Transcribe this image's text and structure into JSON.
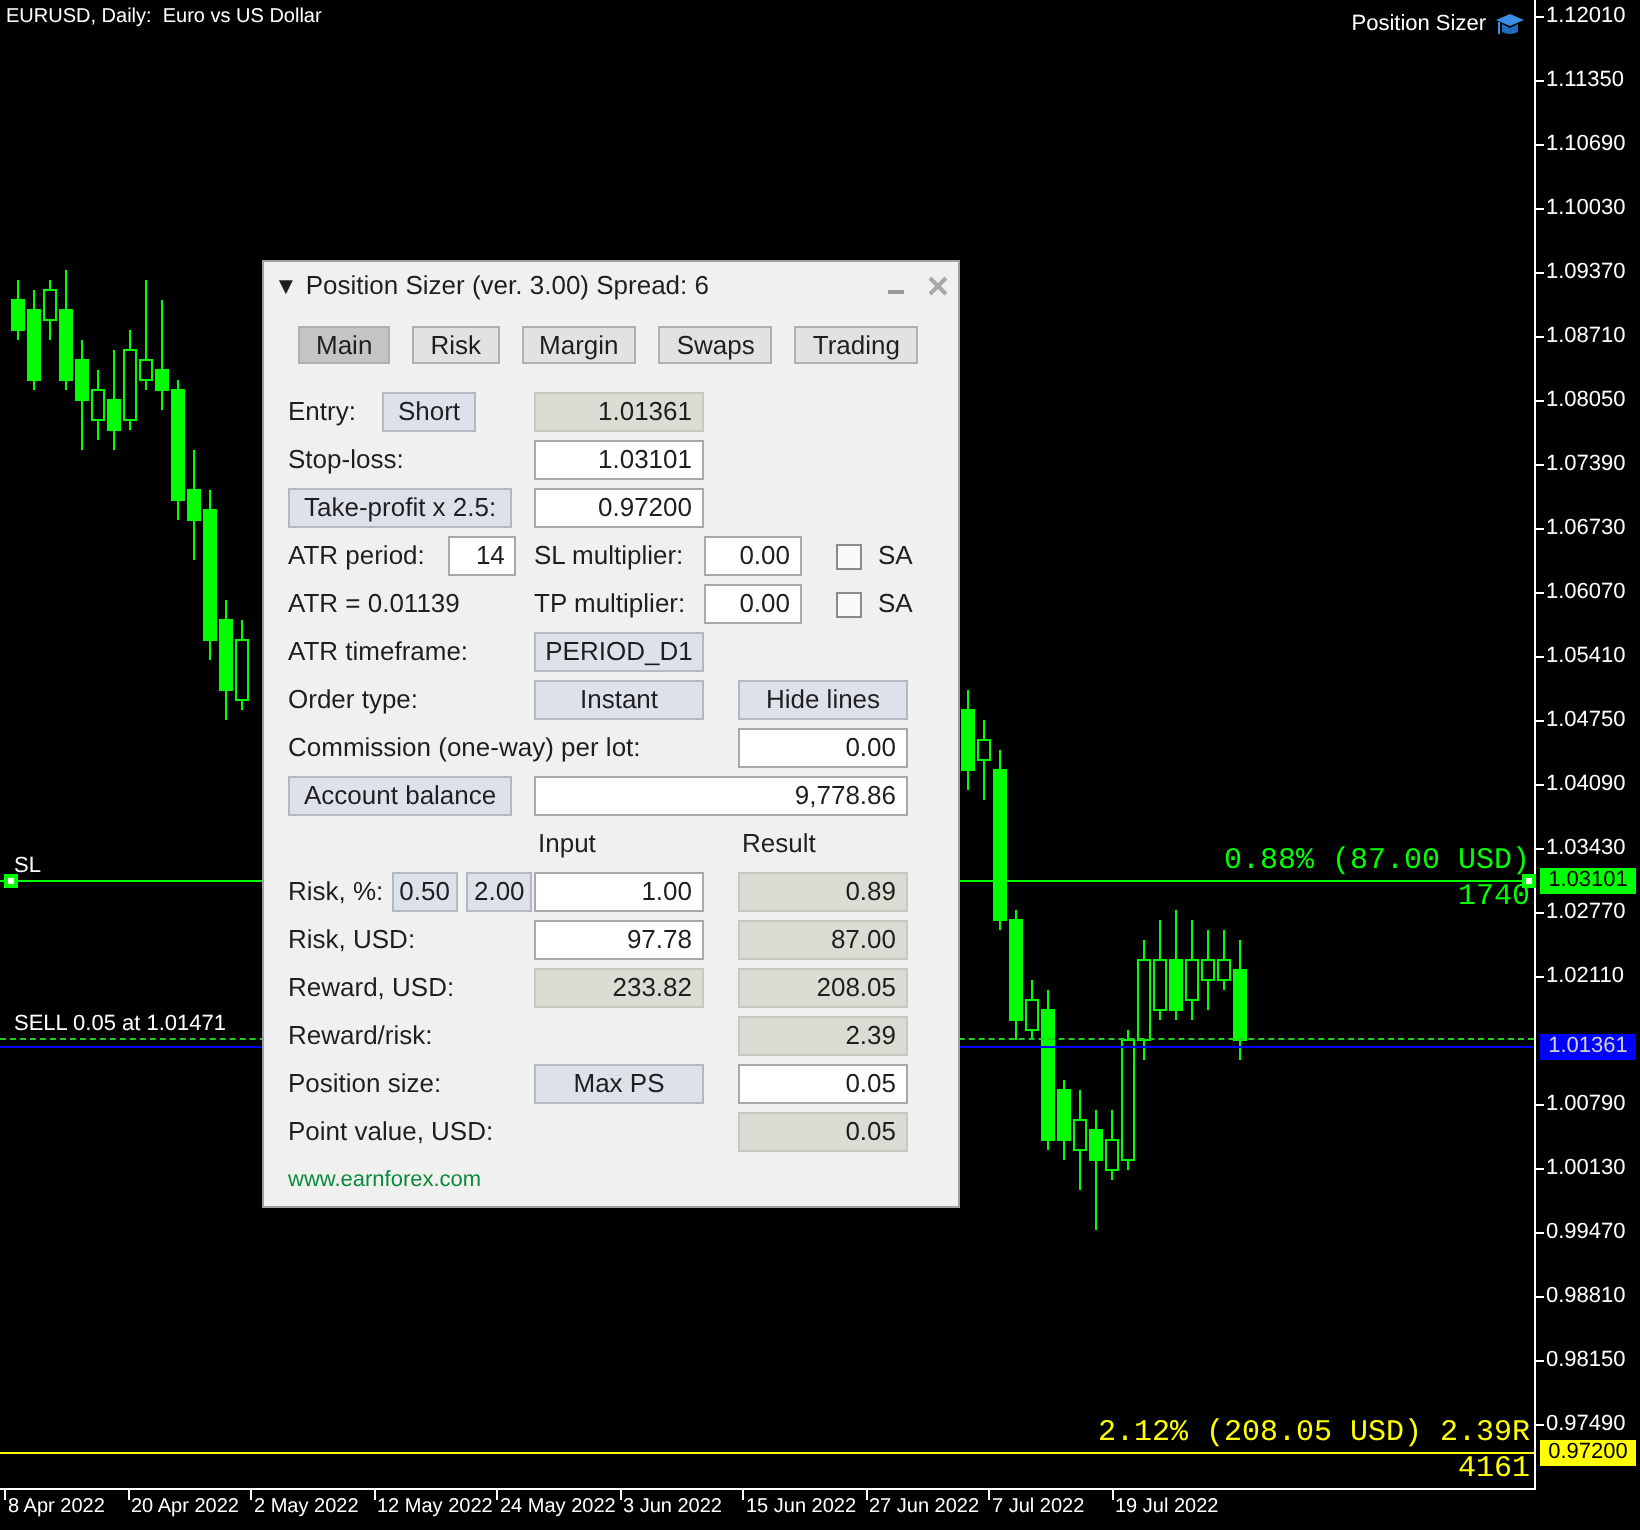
{
  "chart": {
    "title": "EURUSD, Daily:  Euro vs US Dollar",
    "indicator_label": "Position Sizer",
    "price_axis": {
      "upper": [
        "1.12010",
        "1.11350",
        "1.10690",
        "1.10030",
        "1.09370",
        "1.08710",
        "1.08050",
        "1.07390",
        "1.06730",
        "1.06070",
        "1.05410",
        "1.04750",
        "1.04090",
        "1.03430",
        "1.02770",
        "1.02110"
      ],
      "lower": [
        "1.00790",
        "1.00130",
        "0.99470",
        "0.98810",
        "0.98150",
        "0.97490"
      ]
    },
    "date_axis": [
      "8 Apr 2022",
      "20 Apr 2022",
      "2 May 2022",
      "12 May 2022",
      "24 May 2022",
      "3 Jun 2022",
      "15 Jun 2022",
      "27 Jun 2022",
      "7 Jul 2022",
      "19 Jul 2022"
    ],
    "lines": [
      {
        "kind": "sl",
        "label": "SL",
        "info": "0.88% (87.00 USD)",
        "points": "1740",
        "price": "1.03101",
        "color": "#00ff00"
      },
      {
        "kind": "order",
        "label": "SELL 0.05 at 1.01471",
        "color": "#22cc22"
      },
      {
        "kind": "entry",
        "price": "1.01361",
        "color": "#0000ff"
      },
      {
        "kind": "tp",
        "info": "2.12% (208.05 USD) 2.39R",
        "points": "4161",
        "price": "0.97200",
        "color": "#ffff00"
      }
    ]
  },
  "panel": {
    "collapse_glyph": "▼",
    "title": "Position Sizer (ver. 3.00) Spread: 6",
    "tabs": [
      {
        "label": "Main",
        "selected": true
      },
      {
        "label": "Risk",
        "selected": false
      },
      {
        "label": "Margin",
        "selected": false
      },
      {
        "label": "Swaps",
        "selected": false
      },
      {
        "label": "Trading",
        "selected": false
      }
    ],
    "rows": [
      {
        "kind": "grid",
        "left": [
          {
            "kind": "label",
            "text": "Entry:"
          },
          {
            "kind": "button",
            "text": "Short"
          }
        ],
        "input": {
          "kind": "field",
          "value": "1.01361",
          "editable": false
        }
      },
      {
        "kind": "grid",
        "left": [
          {
            "kind": "label",
            "text": "Stop-loss:"
          }
        ],
        "input": {
          "kind": "field",
          "value": "1.03101",
          "editable": true
        }
      },
      {
        "kind": "grid",
        "left": [
          {
            "kind": "button",
            "text": "Take-profit x 2.5:"
          }
        ],
        "input": {
          "kind": "field",
          "value": "0.97200",
          "editable": true
        }
      },
      {
        "kind": "multiplier",
        "left": [
          {
            "kind": "label",
            "text": "ATR period:"
          },
          {
            "kind": "field",
            "value": "14",
            "editable": true
          }
        ],
        "extra": [
          {
            "kind": "label",
            "text": "SL multiplier:"
          },
          {
            "kind": "field",
            "value": "0.00",
            "editable": true
          },
          {
            "kind": "checkbox",
            "checked": false,
            "text": "SA"
          }
        ]
      },
      {
        "kind": "multiplier",
        "left": [
          {
            "kind": "label",
            "text": "ATR = 0.01139"
          }
        ],
        "extra": [
          {
            "kind": "label",
            "text": "TP multiplier:"
          },
          {
            "kind": "field",
            "value": "0.00",
            "editable": true
          },
          {
            "kind": "checkbox",
            "checked": false,
            "text": "SA"
          }
        ]
      },
      {
        "kind": "grid",
        "left": [
          {
            "kind": "label",
            "text": "ATR timeframe:"
          }
        ],
        "input": {
          "kind": "button",
          "text": "PERIOD_D1"
        }
      },
      {
        "kind": "grid",
        "left": [
          {
            "kind": "label",
            "text": "Order type:"
          }
        ],
        "input": {
          "kind": "button",
          "text": "Instant"
        },
        "result": {
          "kind": "button",
          "text": "Hide lines"
        }
      },
      {
        "kind": "wide_label",
        "left": [
          {
            "kind": "label",
            "text": "Commission (one-way) per lot:"
          }
        ],
        "result": {
          "kind": "field",
          "value": "0.00",
          "editable": true
        }
      },
      {
        "kind": "balance",
        "left": [
          {
            "kind": "button",
            "text": "Account balance"
          }
        ],
        "input": {
          "kind": "field",
          "value": "9,778.86",
          "editable": true
        }
      },
      {
        "kind": "grid",
        "input": {
          "kind": "heading",
          "text": "Input"
        },
        "result": {
          "kind": "heading",
          "text": "Result"
        }
      },
      {
        "kind": "grid",
        "left": [
          {
            "kind": "label",
            "text": "Risk, %:"
          },
          {
            "kind": "small_button",
            "text": "0.50"
          },
          {
            "kind": "small_button",
            "text": "2.00"
          }
        ],
        "input": {
          "kind": "field",
          "value": "1.00",
          "editable": true
        },
        "result": {
          "kind": "field",
          "value": "0.89",
          "editable": false
        }
      },
      {
        "kind": "grid",
        "left": [
          {
            "kind": "label",
            "text": "Risk, USD:"
          }
        ],
        "input": {
          "kind": "field",
          "value": "97.78",
          "editable": true
        },
        "result": {
          "kind": "field",
          "value": "87.00",
          "editable": false
        }
      },
      {
        "kind": "grid",
        "left": [
          {
            "kind": "label",
            "text": "Reward, USD:"
          }
        ],
        "input": {
          "kind": "field",
          "value": "233.82",
          "editable": false
        },
        "result": {
          "kind": "field",
          "value": "208.05",
          "editable": false
        }
      },
      {
        "kind": "grid",
        "left": [
          {
            "kind": "label",
            "text": "Reward/risk:"
          }
        ],
        "result": {
          "kind": "field",
          "value": "2.39",
          "editable": false
        }
      },
      {
        "kind": "grid",
        "left": [
          {
            "kind": "label",
            "text": "Position size:"
          }
        ],
        "input": {
          "kind": "button",
          "text": "Max PS"
        },
        "result": {
          "kind": "field",
          "value": "0.05",
          "editable": true
        }
      },
      {
        "kind": "grid",
        "left": [
          {
            "kind": "label",
            "text": "Point value, USD:"
          }
        ],
        "result": {
          "kind": "field",
          "value": "0.05",
          "editable": false
        }
      }
    ],
    "link": "www.earnforex.com"
  }
}
